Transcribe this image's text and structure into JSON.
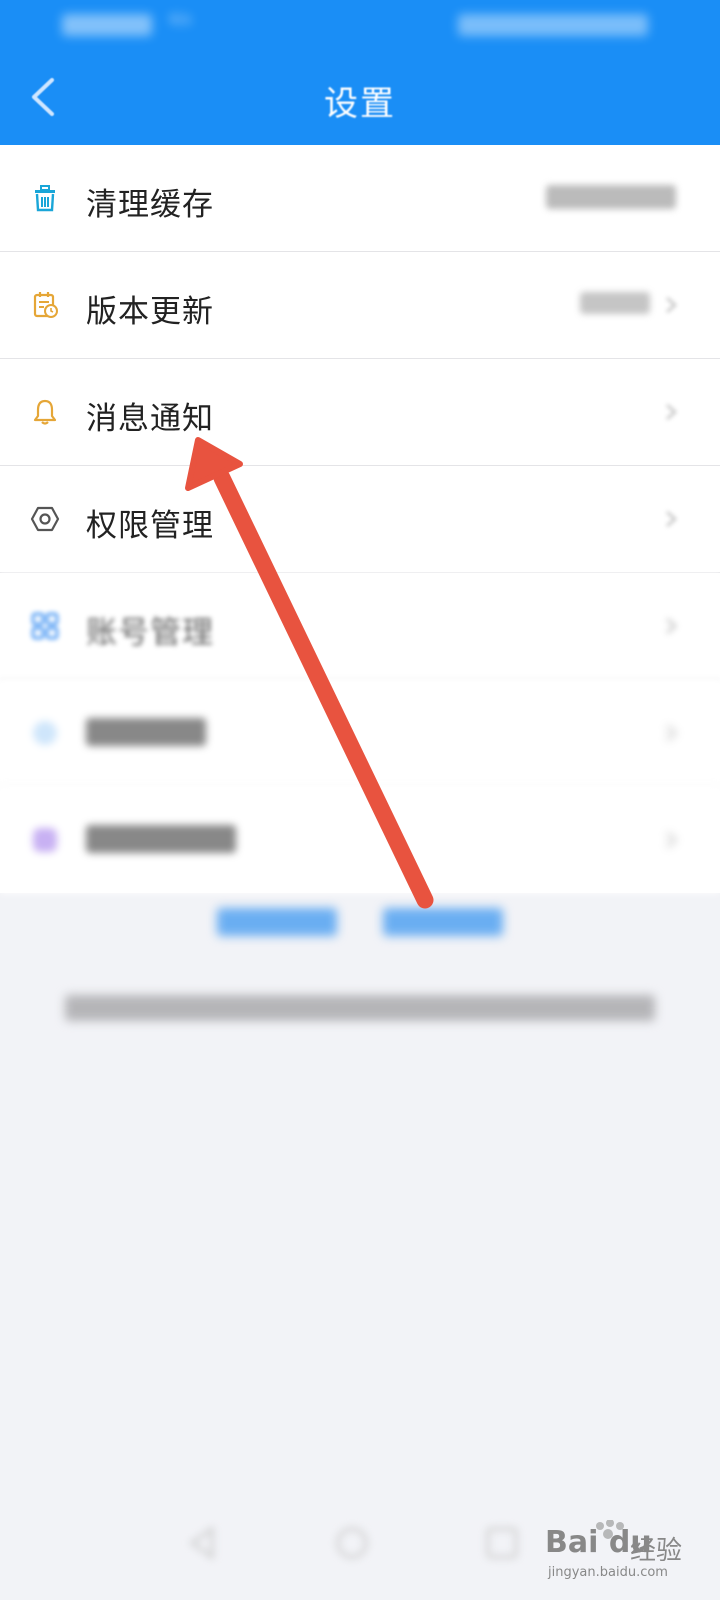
{
  "header": {
    "title": "设置",
    "back_icon": "chevron-left-icon",
    "background": "#1a8ef6"
  },
  "status_bar": {
    "speed_unit": "K/s"
  },
  "settings": {
    "items": [
      {
        "label": "清理缓存",
        "icon": "trash-icon",
        "icon_color": "#1aa6d8"
      },
      {
        "label": "版本更新",
        "icon": "calendar-clock-icon",
        "icon_color": "#e5a637"
      },
      {
        "label": "消息通知",
        "icon": "bell-icon",
        "icon_color": "#e5a637"
      },
      {
        "label": "权限管理",
        "icon": "hexagon-settings-icon",
        "icon_color": "#555555"
      },
      {
        "label": "账号管理",
        "icon": "grid-icon",
        "icon_color": "#3a8ff2"
      },
      {
        "label": "",
        "icon": "info-icon",
        "icon_color": "#73b8f5"
      },
      {
        "label": "",
        "icon": "purple-icon",
        "icon_color": "#9b6cf0"
      }
    ]
  },
  "annotation": {
    "arrow_color": "#e8533f"
  },
  "watermark": {
    "brand": "Bai du",
    "suffix": "经验",
    "url": "jingyan.baidu.com"
  }
}
